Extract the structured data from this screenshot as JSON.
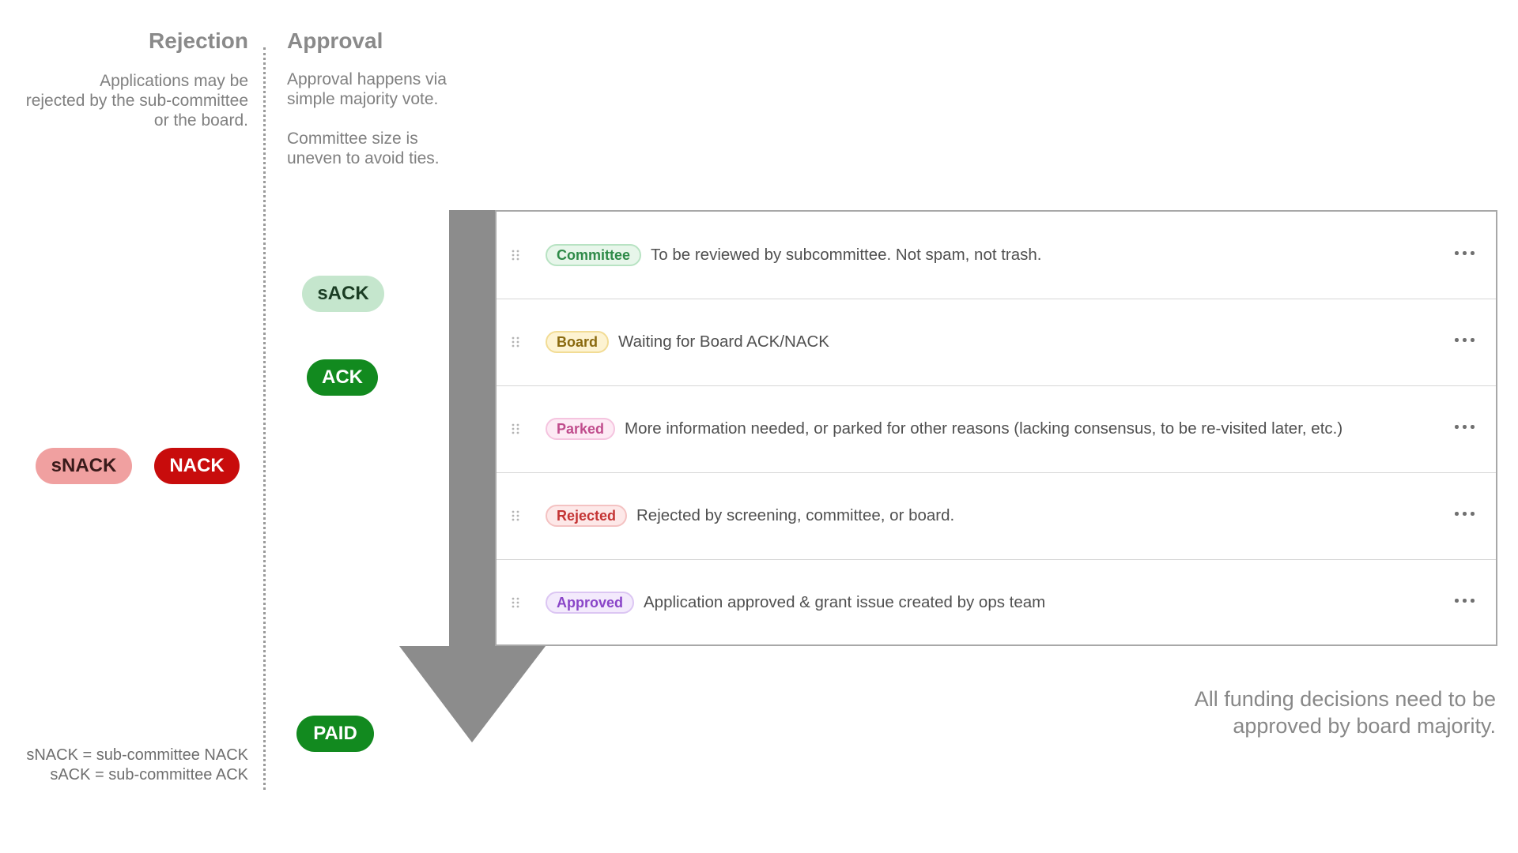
{
  "rejection": {
    "heading": "Rejection",
    "description": "Applications may be\nrejected by the sub-committee\nor the board."
  },
  "approval": {
    "heading": "Approval",
    "description_1": "Approval happens via\nsimple majority vote.",
    "description_2": "Committee size is\nuneven to avoid ties."
  },
  "pills": {
    "sack": "sACK",
    "ack": "ACK",
    "snack": "sNACK",
    "nack": "NACK",
    "paid": "PAID"
  },
  "colors": {
    "ack_green": "#128a1f",
    "sack_green": "#c5e6cd",
    "nack_red": "#c80c0c",
    "snack_red": "#f0a0a0",
    "arrow_gray": "#8c8c8c"
  },
  "statuses": [
    {
      "badge": "Committee",
      "variant": "committee",
      "text": "To be reviewed by subcommittee. Not spam, not trash."
    },
    {
      "badge": "Board",
      "variant": "board",
      "text": "Waiting for Board ACK/NACK"
    },
    {
      "badge": "Parked",
      "variant": "parked",
      "text": "More information needed, or parked for other reasons (lacking consensus, to be re-visited later, etc.)"
    },
    {
      "badge": "Rejected",
      "variant": "rejected",
      "text": "Rejected by screening, committee, or board."
    },
    {
      "badge": "Approved",
      "variant": "approved",
      "text": "Application approved & grant issue created by ops team"
    }
  ],
  "icons": {
    "drag": "drag-handle-icon",
    "more": "more-horizontal-icon",
    "arrow": "down-arrow-icon"
  },
  "footer_note": "All funding decisions need to be\napproved by board majority.",
  "legend_note": "sNACK = sub-committee NACK\nsACK = sub-committee ACK"
}
